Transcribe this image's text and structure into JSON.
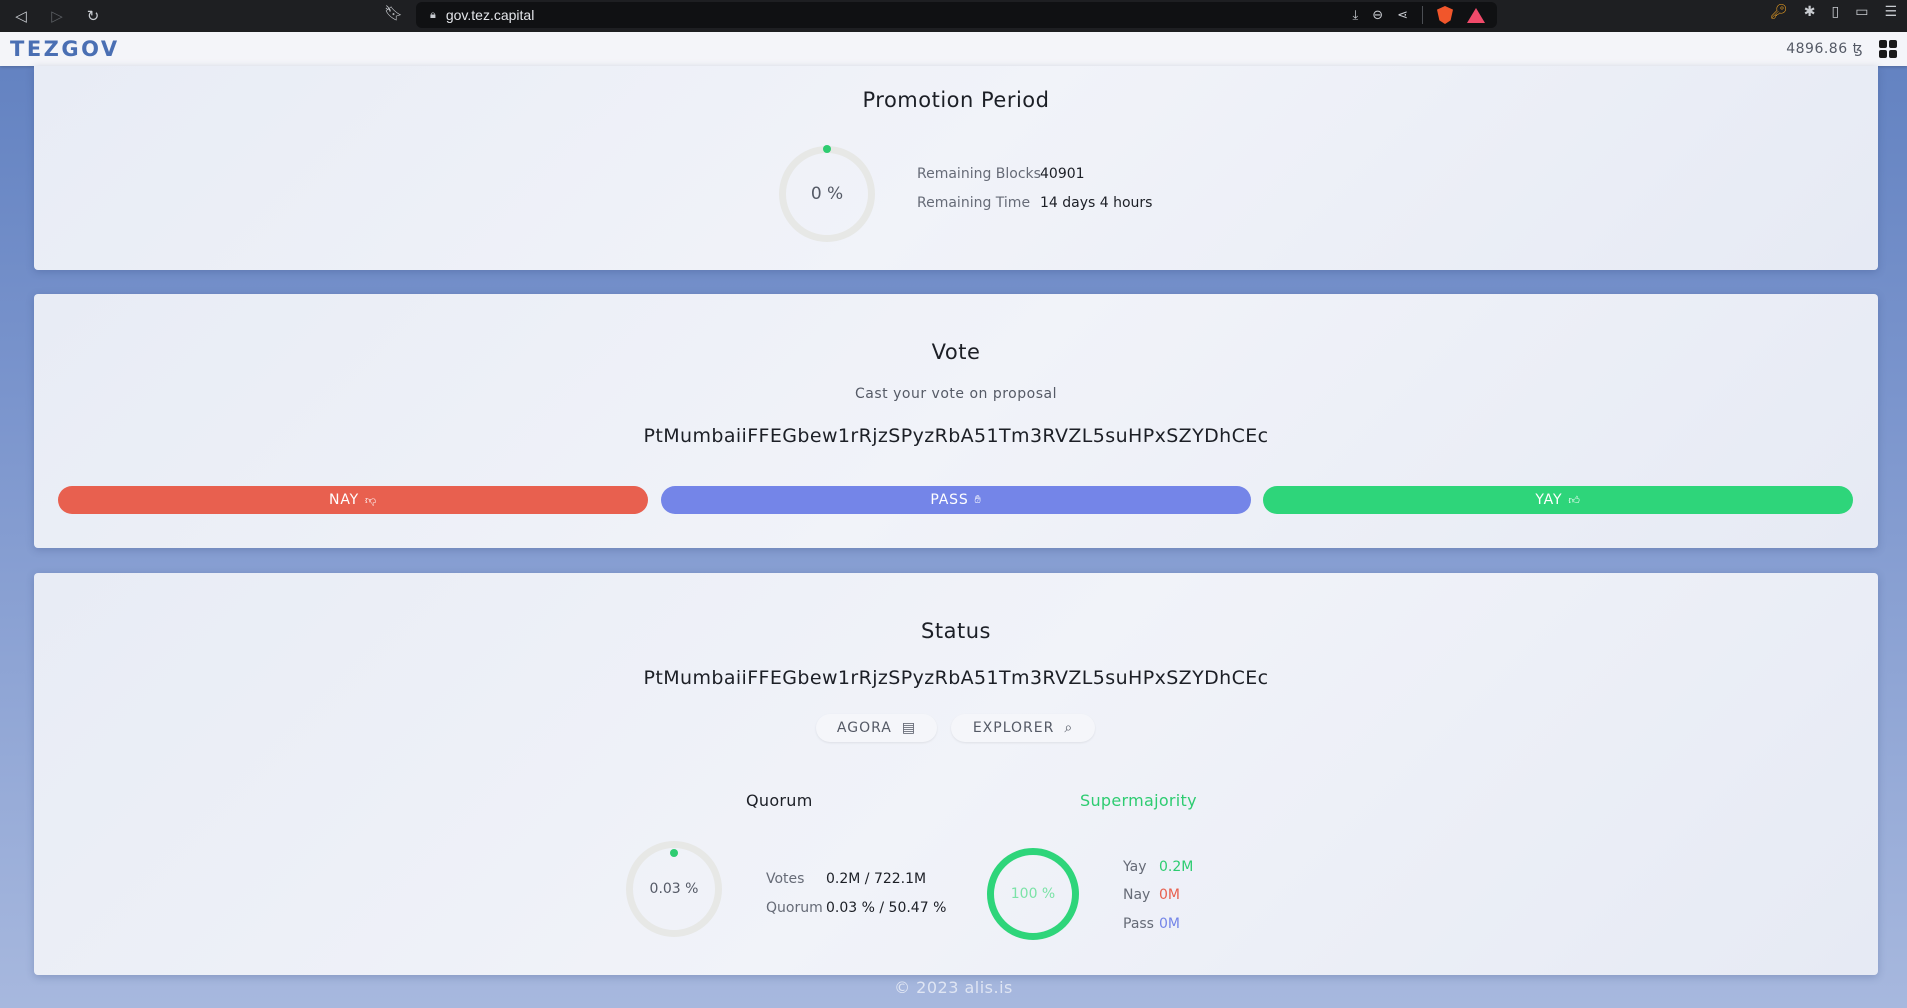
{
  "browser": {
    "url": "gov.tez.capital"
  },
  "header": {
    "logo": "TEZGOV",
    "balance": "4896.86 ꜩ"
  },
  "promotion": {
    "title": "Promotion Period",
    "progress_text": "0 %",
    "progress_fraction": 0.0,
    "remaining_blocks_label": "Remaining Blocks",
    "remaining_blocks_value": "40901",
    "remaining_time_label": "Remaining Time",
    "remaining_time_value": "14 days 4 hours"
  },
  "vote": {
    "title": "Vote",
    "subtitle": "Cast your vote on proposal",
    "proposal": "PtMumbaiiFFEGbew1rRjzSPyzRbA51Tm3RVZL5suHPxSZYDhCEc",
    "nay_label": "NAY",
    "pass_label": "PASS",
    "yay_label": "YAY",
    "colors": {
      "nay": "#e8604f",
      "pass": "#7485e8",
      "yay": "#2ed57a"
    }
  },
  "status": {
    "title": "Status",
    "proposal": "PtMumbaiiFFEGbew1rRjzSPyzRbA51Tm3RVZL5suHPxSZYDhCEc",
    "agora_label": "AGORA",
    "explorer_label": "EXPLORER",
    "quorum": {
      "heading": "Quorum",
      "progress_text": "0.03 %",
      "progress_fraction": 0.0003,
      "votes_label": "Votes",
      "votes_value": "0.2M / 722.1M",
      "quorum_label": "Quorum",
      "quorum_value": "0.03 % / 50.47 %"
    },
    "supermajority": {
      "heading": "Supermajority",
      "progress_text": "100 %",
      "progress_fraction": 1.0,
      "yay_label": "Yay",
      "yay_value": "0.2M",
      "nay_label": "Nay",
      "nay_value": "0M",
      "pass_label": "Pass",
      "pass_value": "0M"
    }
  },
  "footer": {
    "text": "© 2023 alis.is"
  }
}
